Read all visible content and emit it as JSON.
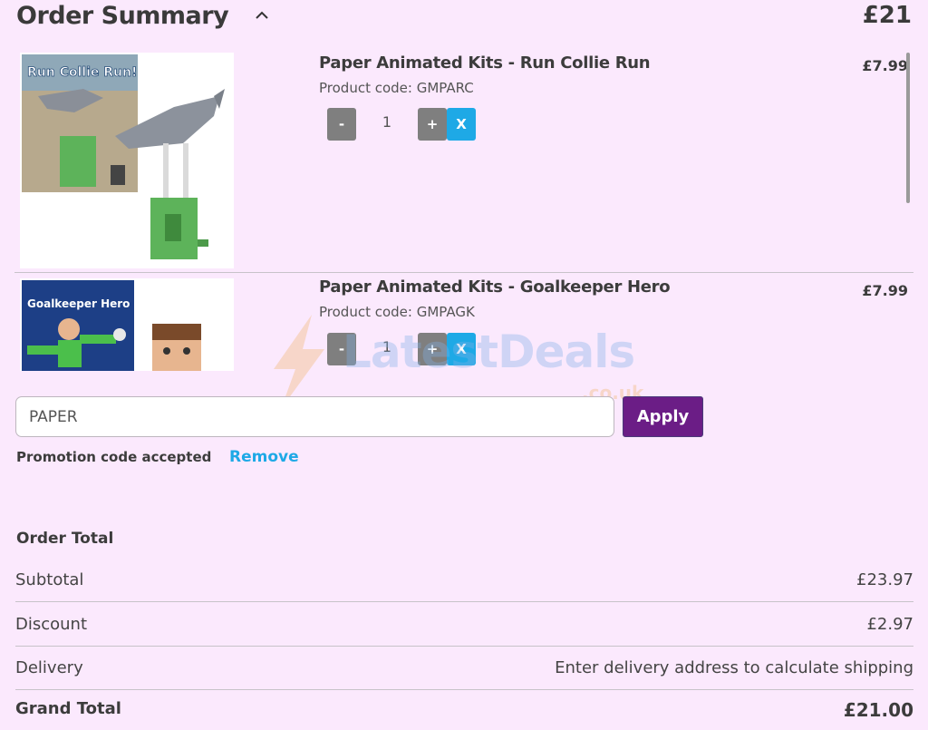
{
  "header": {
    "title": "Order Summary",
    "total": "£21"
  },
  "items": [
    {
      "name": "Paper Animated Kits - Run Collie Run",
      "code": "Product code: GMPARC",
      "price": "£7.99",
      "quantity": "1",
      "box_title": "Run Collie Run!",
      "minus_label": "-",
      "plus_label": "+",
      "remove_label": "X"
    },
    {
      "name": "Paper Animated Kits - Goalkeeper Hero",
      "code": "Product code: GMPAGK",
      "price": "£7.99",
      "quantity": "1",
      "box_title": "Goalkeeper Hero",
      "minus_label": "-",
      "plus_label": "+",
      "remove_label": "X"
    }
  ],
  "watermark": {
    "text": "LatestDeals",
    "sub": ".co.uk"
  },
  "promo": {
    "code_value": "PAPER",
    "apply_label": "Apply",
    "status": "Promotion code  accepted",
    "remove_label": "Remove"
  },
  "totals": {
    "heading": "Order Total",
    "subtotal_label": "Subtotal",
    "subtotal_value": "£23.97",
    "discount_label": "Discount",
    "discount_value": "£2.97",
    "delivery_label": "Delivery",
    "delivery_value": "Enter delivery address to calculate shipping",
    "grand_label": "Grand Total",
    "grand_value": "£21.00"
  },
  "colors": {
    "background": "#fbe9fd",
    "apply_button": "#6b1d86",
    "remove_accent": "#1ea9e6",
    "qty_button": "#7f7f7f"
  }
}
